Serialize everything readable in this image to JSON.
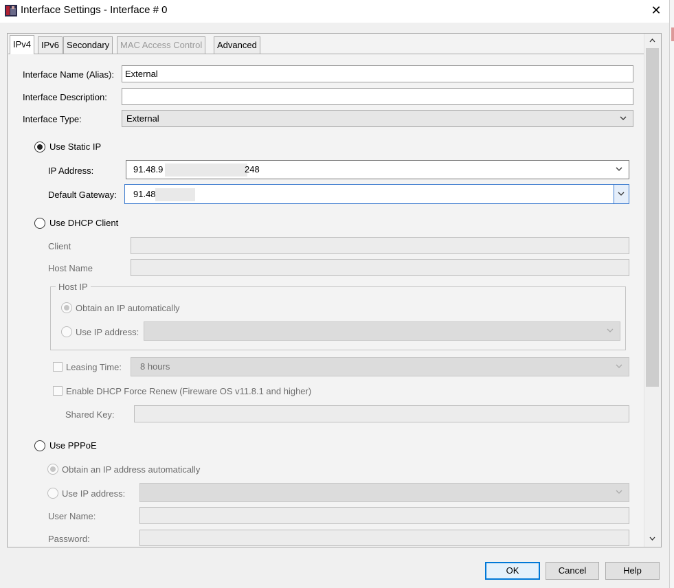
{
  "window": {
    "title": "Interface Settings - Interface # 0",
    "close_glyph": "✕"
  },
  "tabs": [
    {
      "label": "IPv4",
      "active": true,
      "enabled": true
    },
    {
      "label": "IPv6",
      "active": false,
      "enabled": true
    },
    {
      "label": "Secondary",
      "active": false,
      "enabled": true
    },
    {
      "label": "MAC Access Control",
      "active": false,
      "enabled": false
    },
    {
      "label": "Advanced",
      "active": false,
      "enabled": true
    }
  ],
  "general": {
    "name_label": "Interface Name (Alias):",
    "name_value": "External",
    "description_label": "Interface Description:",
    "description_value": "",
    "type_label": "Interface Type:",
    "type_value": "External"
  },
  "static_ip": {
    "label": "Use Static IP",
    "selected": true,
    "ip_label": "IP Address:",
    "ip_value_start": "91.48.9",
    "ip_value_end": "248",
    "gateway_label": "Default Gateway:",
    "gateway_value": "91.48"
  },
  "dhcp": {
    "label": "Use DHCP Client",
    "selected": false,
    "client_label": "Client",
    "host_name_label": "Host Name",
    "host_ip_group": "Host IP",
    "obtain_label": "Obtain an IP automatically",
    "use_ip_label": "Use IP address:",
    "leasing_label": "Leasing Time:",
    "leasing_value": "8 hours",
    "force_renew_label": "Enable DHCP Force Renew (Fireware OS v11.8.1 and higher)",
    "shared_key_label": "Shared Key:"
  },
  "pppoe": {
    "label": "Use PPPoE",
    "selected": false,
    "obtain_label": "Obtain an IP address automatically",
    "use_ip_label": "Use IP address:",
    "user_name_label": "User Name:",
    "password_label": "Password:"
  },
  "buttons": {
    "ok": "OK",
    "cancel": "Cancel",
    "help": "Help"
  },
  "icons": {
    "app": "watchguard-app-icon",
    "close": "close-icon",
    "dropdown": "chevron-down-icon",
    "scroll_up": "chevron-up-icon",
    "scroll_down": "chevron-down-icon"
  },
  "colors": {
    "focus_border": "#3d7bcf",
    "default_button": "#0078d7"
  }
}
